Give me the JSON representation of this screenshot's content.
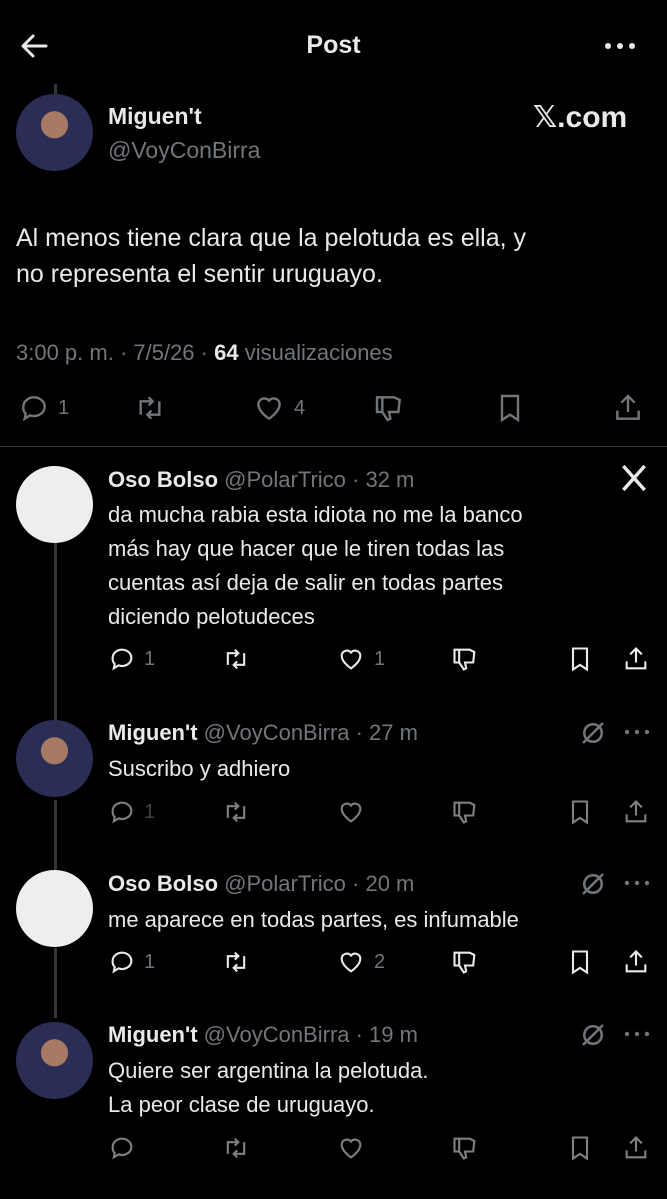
{
  "header": {
    "title": "Post"
  },
  "main_post": {
    "author_name": "Miguen't",
    "author_handle": "@VoyConBirra",
    "watermark": "𝕏.com",
    "text_line1": "Al menos tiene clara que la pelotuda es ella, y",
    "text_line2": "no representa el sentir uruguayo.",
    "time": "3:00 p. m. · 7/5/26 · ",
    "views": "64",
    "views_label": " visualizaciones",
    "replies": "1",
    "likes": "4"
  },
  "replies": [
    {
      "name": "Oso Bolso",
      "handle": "@PolarTrico · 32 m",
      "lines": [
        "da mucha rabia esta idiota no me la banco",
        "más hay que hacer que le tiren todas las",
        "cuentas así deja de salir en todas partes",
        "diciendo pelotudeces"
      ],
      "replies": "1",
      "likes": "1"
    },
    {
      "name": "Miguen't",
      "handle": "@VoyConBirra · 27 m",
      "lines": [
        "Suscribo y adhiero"
      ],
      "replies": "1",
      "likes": ""
    },
    {
      "name": "Oso Bolso",
      "handle": "@PolarTrico · 20 m",
      "lines": [
        "me aparece en todas partes, es infumable"
      ],
      "replies": "1",
      "likes": "2"
    },
    {
      "name": "Miguen't",
      "handle": "@VoyConBirra · 19 m",
      "lines": [
        "Quiere ser argentina la pelotuda.",
        "La peor clase de uruguayo."
      ],
      "replies": "",
      "likes": ""
    }
  ]
}
